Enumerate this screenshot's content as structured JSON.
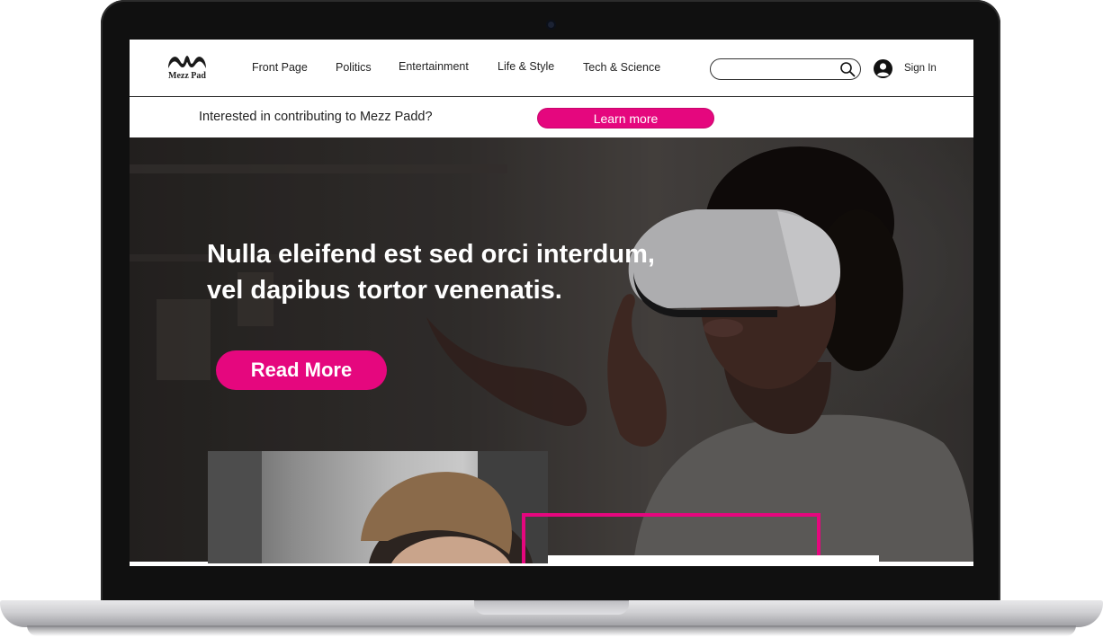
{
  "brand": {
    "logo_text": "Mezz Pad",
    "accent_color": "#e5077e"
  },
  "header": {
    "nav": [
      "Front Page",
      "Politics",
      "Entertainment",
      "Life & Style",
      "Tech & Science"
    ],
    "search": {
      "placeholder": "",
      "icon": "search-icon"
    },
    "account": {
      "icon": "user-avatar-icon",
      "label": "Sign In"
    }
  },
  "promo": {
    "text": "Interested in contributing to Mezz Padd?",
    "button_label": "Learn more"
  },
  "hero": {
    "headline_line1": "Nulla eleifend est sed orci interdum,",
    "headline_line2": "vel dapibus tortor venenatis.",
    "button_label": "Read More"
  }
}
